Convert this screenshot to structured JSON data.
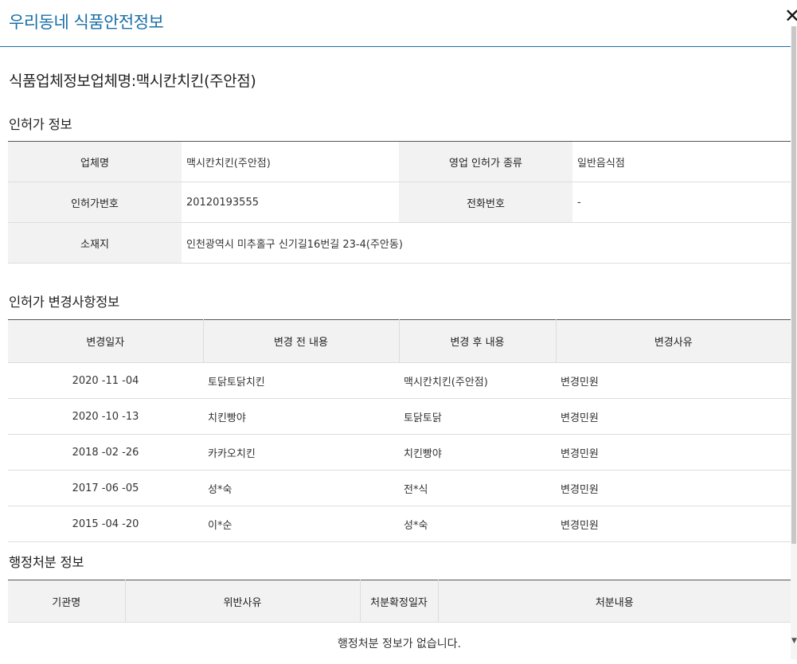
{
  "app": {
    "title": "우리동네 식품안전정보"
  },
  "page": {
    "title": "식품업체정보업체명:맥시칸치킨(주안점)"
  },
  "license": {
    "section_title": "인허가 정보",
    "business_name_label": "업체명",
    "business_name": "맥시칸치킨(주안점)",
    "license_type_label": "영업 인허가 종류",
    "license_type": "일반음식점",
    "license_no_label": "인허가번호",
    "license_no": "20120193555",
    "phone_label": "전화번호",
    "phone": "-",
    "address_label": "소재지",
    "address": "인천광역시 미추홀구 신기길16번길 23-4(주안동)"
  },
  "history": {
    "section_title": "인허가 변경사항정보",
    "headers": [
      "변경일자",
      "변경 전 내용",
      "변경 후 내용",
      "변경사유"
    ],
    "rows": [
      [
        "2020 -11 -04",
        "토닭토닭치킨",
        "맥시칸치킨(주안점)",
        "변경민원"
      ],
      [
        "2020 -10 -13",
        "치킨빵야",
        "토닭토닭",
        "변경민원"
      ],
      [
        "2018 -02 -26",
        "카카오치킨",
        "치킨빵야",
        "변경민원"
      ],
      [
        "2017 -06 -05",
        "성*숙",
        "전*식",
        "변경민원"
      ],
      [
        "2015 -04 -20",
        "이*순",
        "성*숙",
        "변경민원"
      ]
    ]
  },
  "admin": {
    "section_title": "행정처분 정보",
    "headers": [
      "기관명",
      "위반사유",
      "처분확정일자",
      "처분내용"
    ],
    "empty_message": "행정처분 정보가 없습니다."
  }
}
